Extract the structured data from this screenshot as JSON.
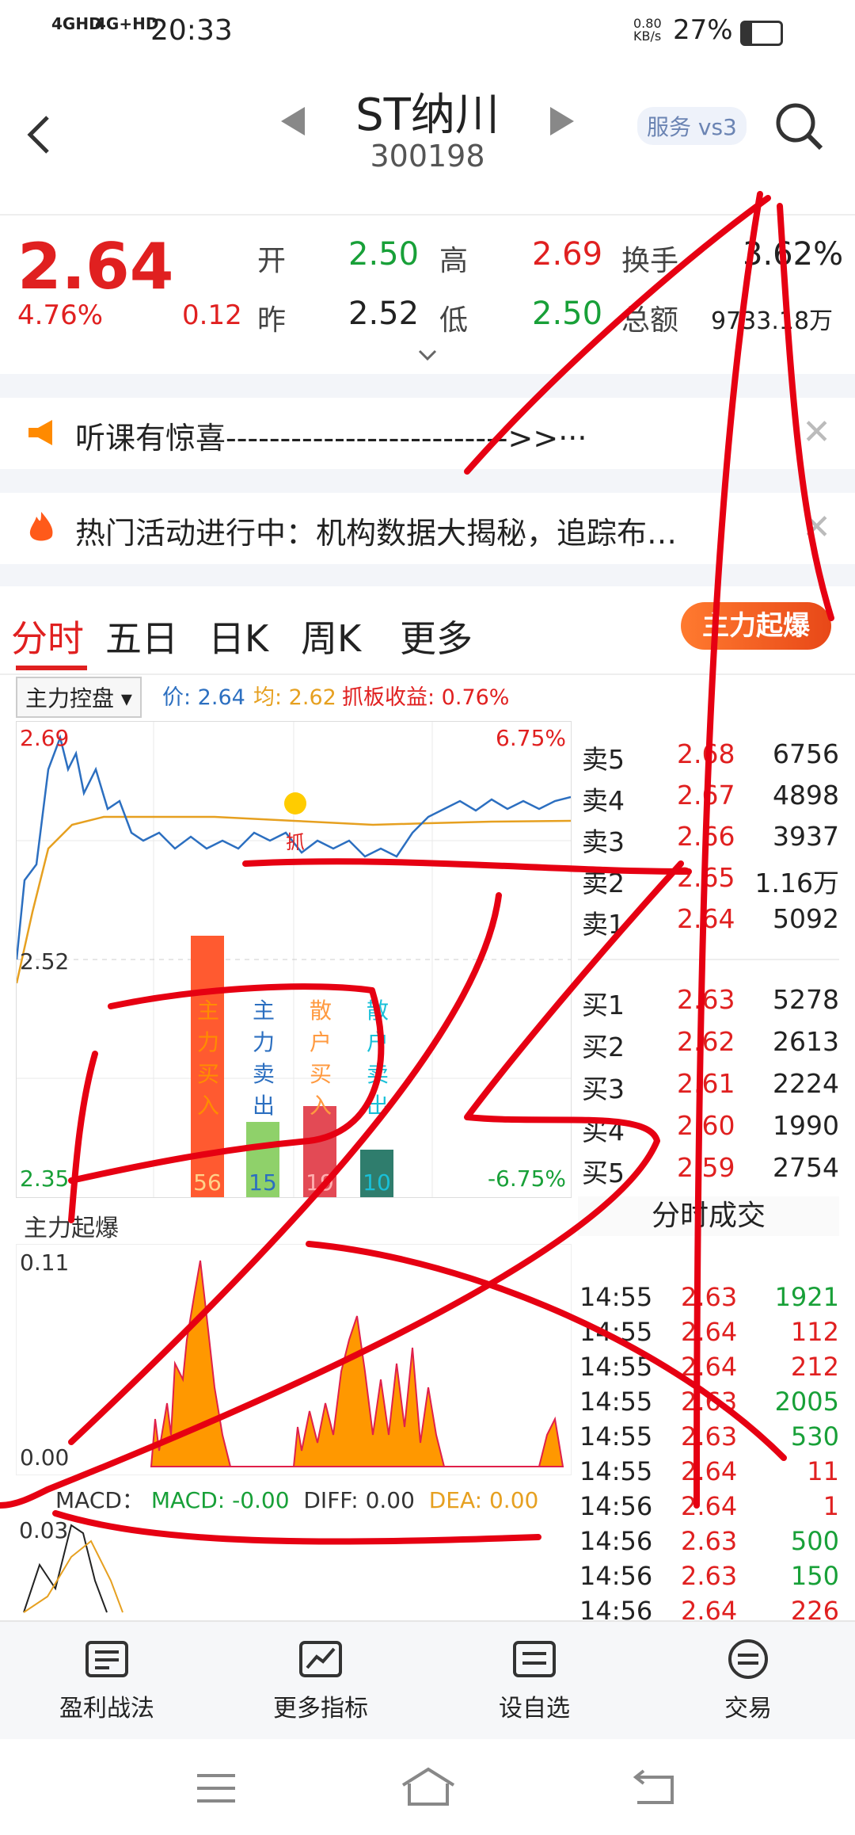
{
  "status_bar": {
    "net1": "4GHD",
    "net2": "4G+HD",
    "time": "20:33",
    "speed_value": "0.80",
    "speed_unit": "KB/s",
    "battery": "27%"
  },
  "header": {
    "title": "ST纳川",
    "code": "300198",
    "service_label": "服务 vs3"
  },
  "quote": {
    "price": "2.64",
    "change_pct": "4.76%",
    "change": "0.12",
    "open_label": "开",
    "open": "2.50",
    "high_label": "高",
    "high": "2.69",
    "turnover_label": "换手",
    "turnover": "3.62%",
    "prev_label": "昨",
    "prev": "2.52",
    "low_label": "低",
    "low": "2.50",
    "amount_label": "总额",
    "amount": "9733.18万"
  },
  "notices": [
    {
      "text": "听课有惊喜-------------------------->>···"
    },
    {
      "text": "热门活动进行中：机构数据大揭秘，追踪布…"
    }
  ],
  "tabs": [
    "分时",
    "五日",
    "日K",
    "周K",
    "更多"
  ],
  "boom_button": "主力起爆",
  "control": {
    "dropdown": "主力控盘",
    "price_label": "价: 2.64",
    "avg_label": "均: 2.62",
    "grab_label": "抓板收益: 0.76%"
  },
  "chart_labels": {
    "top_price": "2.69",
    "top_pct": "6.75%",
    "mid_price": "2.52",
    "bot_price": "2.35",
    "bot_pct": "-6.75%",
    "grab_marker": "抓"
  },
  "bars": [
    {
      "label": "主力买入",
      "value": "56",
      "color": "#ff5a30",
      "text_color": "#ff8c00"
    },
    {
      "label": "主力卖出",
      "value": "15",
      "color": "#8fd16a",
      "text_color": "#2c6fc0"
    },
    {
      "label": "散户买入",
      "value": "19",
      "color": "#e34a55",
      "text_color": "#ff9a40"
    },
    {
      "label": "散户卖出",
      "value": "10",
      "color": "#2f7d6d",
      "text_color": "#19c0d8"
    }
  ],
  "orderbook": {
    "asks": [
      {
        "label": "卖5",
        "price": "2.68",
        "vol": "6756"
      },
      {
        "label": "卖4",
        "price": "2.67",
        "vol": "4898"
      },
      {
        "label": "卖3",
        "price": "2.66",
        "vol": "3937"
      },
      {
        "label": "卖2",
        "price": "2.65",
        "vol": "1.16万"
      },
      {
        "label": "卖1",
        "price": "2.64",
        "vol": "5092"
      }
    ],
    "bids": [
      {
        "label": "买1",
        "price": "2.63",
        "vol": "5278"
      },
      {
        "label": "买2",
        "price": "2.62",
        "vol": "2613"
      },
      {
        "label": "买3",
        "price": "2.61",
        "vol": "2224"
      },
      {
        "label": "买4",
        "price": "2.60",
        "vol": "1990"
      },
      {
        "label": "买5",
        "price": "2.59",
        "vol": "2754"
      }
    ]
  },
  "subchart": {
    "title": "主力起爆",
    "top": "0.11",
    "bottom": "0.00",
    "macd_label": "MACD：",
    "macd": "MACD: -0.00",
    "diff": "DIFF: 0.00",
    "dea": "DEA: 0.00",
    "macd_top": "0.03"
  },
  "ticks_title": "分时成交",
  "ticks": [
    {
      "time": "14:55",
      "price": "2.63",
      "vol": "1921",
      "side": "buy"
    },
    {
      "time": "14:55",
      "price": "2.64",
      "vol": "112",
      "side": "sell"
    },
    {
      "time": "14:55",
      "price": "2.64",
      "vol": "212",
      "side": "sell"
    },
    {
      "time": "14:55",
      "price": "2.63",
      "vol": "2005",
      "side": "buy"
    },
    {
      "time": "14:55",
      "price": "2.63",
      "vol": "530",
      "side": "buy"
    },
    {
      "time": "14:55",
      "price": "2.64",
      "vol": "11",
      "side": "sell"
    },
    {
      "time": "14:56",
      "price": "2.64",
      "vol": "1",
      "side": "sell"
    },
    {
      "time": "14:56",
      "price": "2.63",
      "vol": "500",
      "side": "buy"
    },
    {
      "time": "14:56",
      "price": "2.63",
      "vol": "150",
      "side": "buy"
    },
    {
      "time": "14:56",
      "price": "2.64",
      "vol": "226",
      "side": "sell"
    }
  ],
  "bottom_nav": [
    "盈利战法",
    "更多指标",
    "设自选",
    "交易"
  ],
  "colors": {
    "up": "#e02020",
    "down": "#18a038",
    "accent": "#e84818"
  }
}
